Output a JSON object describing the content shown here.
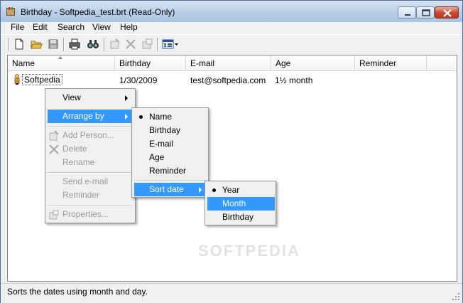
{
  "window": {
    "title": "Birthday - Softpedia_test.brt (Read-Only)"
  },
  "menubar": [
    "File",
    "Edit",
    "Search",
    "View",
    "Help"
  ],
  "toolbar": {
    "icons": [
      "new-file-icon",
      "open-folder-icon",
      "save-icon",
      "print-icon",
      "find-icon",
      "add-person-icon",
      "delete-icon",
      "properties-icon",
      "view-options-icon"
    ]
  },
  "list": {
    "columns": [
      "Name",
      "Birthday",
      "E-mail",
      "Age",
      "Reminder"
    ],
    "rows": [
      {
        "name": "Softpedia",
        "birthday": "1/30/2009",
        "email": "test@softpedia.com",
        "age": "1½ month",
        "reminder": ""
      }
    ]
  },
  "context_menu": {
    "items": [
      {
        "label": "View",
        "enabled": true,
        "submenu": true
      },
      {
        "label": "Arrange by",
        "enabled": true,
        "submenu": true,
        "highlighted": true
      },
      {
        "label": "Add Person...",
        "enabled": false
      },
      {
        "label": "Delete",
        "enabled": false
      },
      {
        "label": "Rename",
        "enabled": false
      },
      {
        "label": "Send e-mail",
        "enabled": false
      },
      {
        "label": "Reminder",
        "enabled": false
      },
      {
        "label": "Properties...",
        "enabled": false
      }
    ]
  },
  "arrange_menu": {
    "items": [
      "Name",
      "Birthday",
      "E-mail",
      "Age",
      "Reminder"
    ],
    "checked": "Name",
    "sort_date_label": "Sort date"
  },
  "sort_date_menu": {
    "items": [
      "Year",
      "Month",
      "Birthday"
    ],
    "checked": "Year",
    "highlighted": "Month"
  },
  "watermark": "SOFTPEDIA",
  "status": {
    "text": "Sorts the dates using month and day."
  },
  "colors": {
    "highlight": "#3399ff",
    "title_gradient": "#b9cfe8"
  }
}
